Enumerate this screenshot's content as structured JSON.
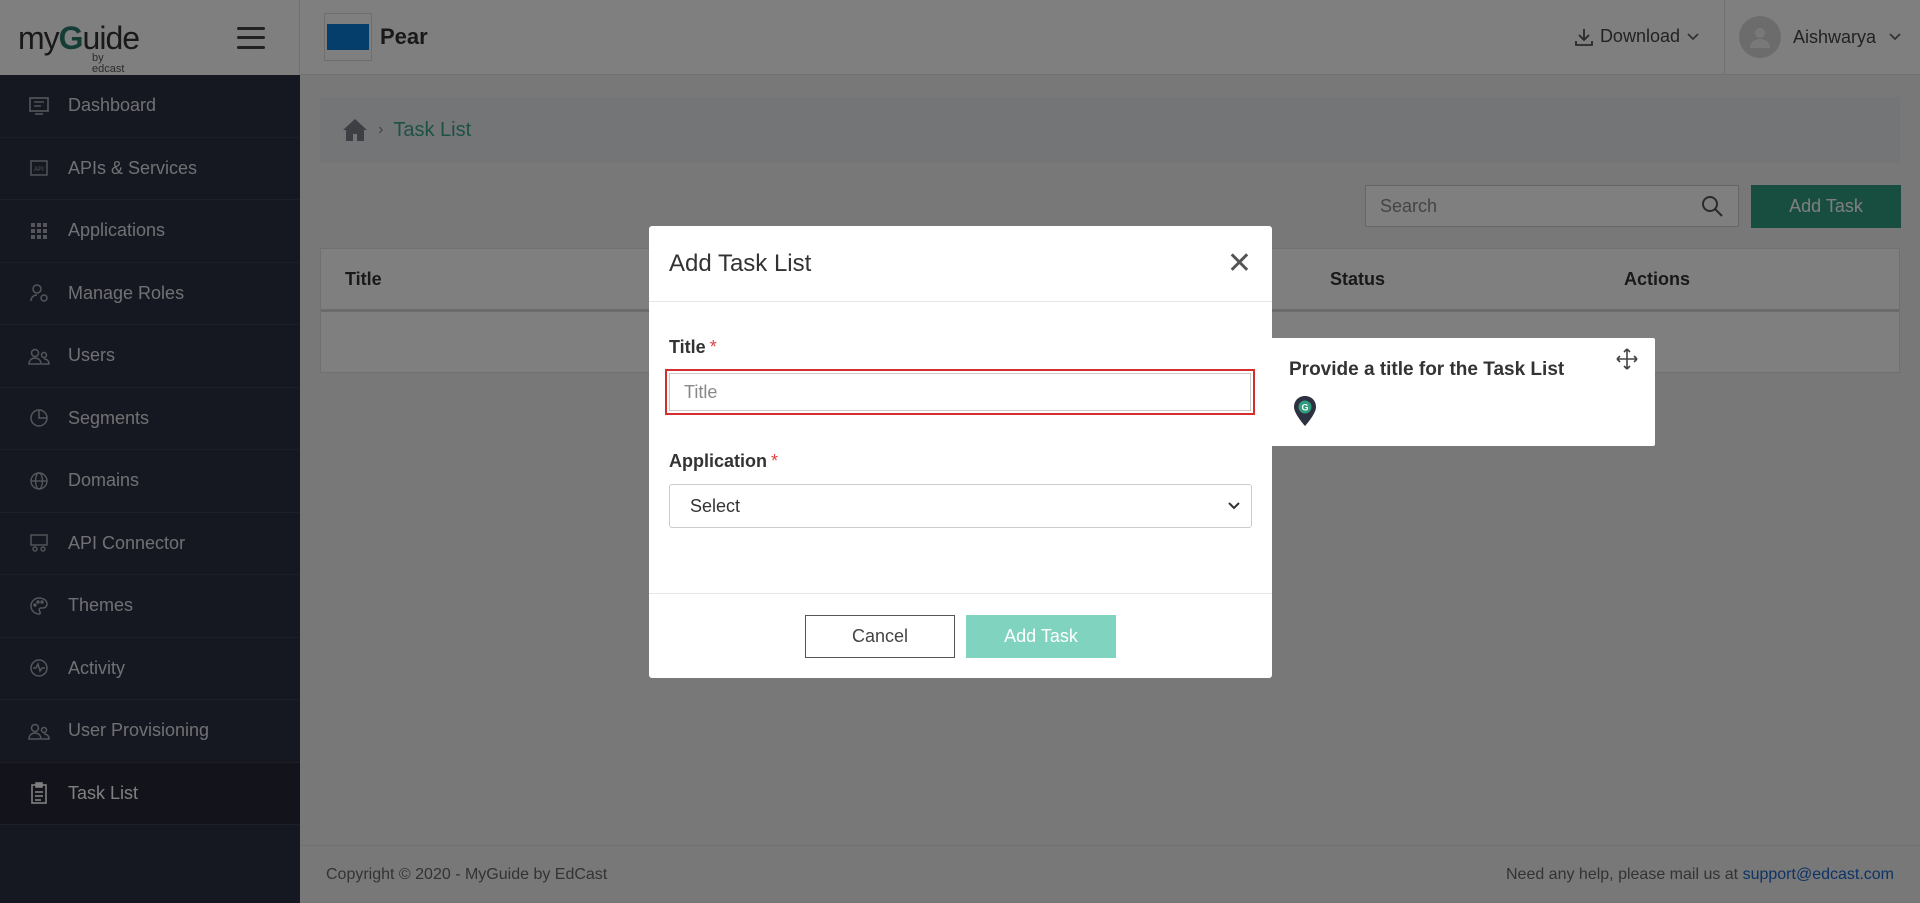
{
  "brand": {
    "logo_text_pre": "my",
    "logo_text_g": "G",
    "logo_text_post": "uide",
    "logo_sub": "by edcast"
  },
  "sidebar": {
    "items": [
      {
        "label": "Dashboard",
        "icon": "dashboard-icon"
      },
      {
        "label": "APIs & Services",
        "icon": "api-icon"
      },
      {
        "label": "Applications",
        "icon": "grid-icon"
      },
      {
        "label": "Manage Roles",
        "icon": "roles-icon"
      },
      {
        "label": "Users",
        "icon": "users-icon"
      },
      {
        "label": "Segments",
        "icon": "pie-icon"
      },
      {
        "label": "Domains",
        "icon": "globe-icon"
      },
      {
        "label": "API Connector",
        "icon": "connector-icon"
      },
      {
        "label": "Themes",
        "icon": "palette-icon"
      },
      {
        "label": "Activity",
        "icon": "activity-icon"
      },
      {
        "label": "User Provisioning",
        "icon": "users-icon"
      },
      {
        "label": "Task List",
        "icon": "clipboard-icon",
        "active": true
      }
    ]
  },
  "header": {
    "app_name": "Pear",
    "download_label": "Download",
    "user_name": "Aishwarya",
    "app_color": "#0a7cd6"
  },
  "breadcrumb": {
    "current": "Task List"
  },
  "toolbar": {
    "search_placeholder": "Search",
    "add_task_label": "Add Task"
  },
  "table": {
    "columns": [
      "Title",
      "Status",
      "Actions"
    ]
  },
  "footer": {
    "copyright": "Copyright © 2020 - MyGuide by EdCast",
    "help_text": "Need any help, please mail us at",
    "email": "support@edcast.com"
  },
  "modal": {
    "title": "Add Task List",
    "title_label": "Title",
    "title_placeholder": "Title",
    "application_label": "Application",
    "application_value": "Select",
    "required_mark": "*",
    "cancel_label": "Cancel",
    "add_label": "Add Task"
  },
  "tooltip": {
    "text": "Provide a title for the Task List"
  },
  "colors": {
    "sidebar_bg": "#2d3142",
    "accent": "#2f9c7e",
    "accent_disabled": "#80d3bf",
    "error": "#d32f2f"
  }
}
